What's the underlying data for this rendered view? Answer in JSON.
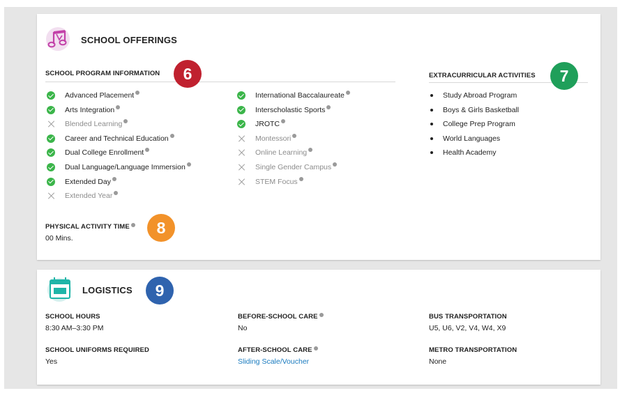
{
  "offerings": {
    "title": "SCHOOL OFFERINGS",
    "program_title": "SCHOOL PROGRAM INFORMATION",
    "program_col1": [
      {
        "label": "Advanced Placement",
        "on": true
      },
      {
        "label": "Arts Integration",
        "on": true
      },
      {
        "label": "Blended Learning",
        "on": false
      },
      {
        "label": "Career and Technical Education",
        "on": true
      },
      {
        "label": "Dual College Enrollment",
        "on": true
      },
      {
        "label": "Dual Language/Language Immersion",
        "on": true
      },
      {
        "label": "Extended Day",
        "on": true
      },
      {
        "label": "Extended Year",
        "on": false
      }
    ],
    "program_col2": [
      {
        "label": "International Baccalaureate",
        "on": true
      },
      {
        "label": "Interscholastic Sports",
        "on": true
      },
      {
        "label": "JROTC",
        "on": true
      },
      {
        "label": "Montessori",
        "on": false
      },
      {
        "label": "Online Learning",
        "on": false
      },
      {
        "label": "Single Gender Campus",
        "on": false
      },
      {
        "label": "STEM Focus",
        "on": false
      }
    ],
    "extra_title": "EXTRACURRICULAR ACTIVITIES",
    "extra_items": [
      "Study Abroad Program",
      "Boys & Girls Basketball",
      "College Prep Program",
      "World Languages",
      "Health Academy"
    ],
    "pa_title": "PHYSICAL ACTIVITY TIME",
    "pa_value": "00 Mins."
  },
  "badges": {
    "b6": {
      "text": "6",
      "color": "#c0212f"
    },
    "b7": {
      "text": "7",
      "color": "#1f9f5a"
    },
    "b8": {
      "text": "8",
      "color": "#f2922a"
    },
    "b9": {
      "text": "9",
      "color": "#2f63ae"
    }
  },
  "logistics": {
    "title": "LOGISTICS",
    "school_hours_label": "SCHOOL HOURS",
    "school_hours_value": "8:30 AM–3:30 PM",
    "before_care_label": "BEFORE-SCHOOL CARE",
    "before_care_value": "No",
    "bus_label": "BUS TRANSPORTATION",
    "bus_value": "U5, U6, V2, V4, W4, X9",
    "uniforms_label": "SCHOOL UNIFORMS REQUIRED",
    "uniforms_value": "Yes",
    "after_care_label": "AFTER-SCHOOL CARE",
    "after_care_value": "Sliding Scale/Voucher",
    "metro_label": "METRO TRANSPORTATION",
    "metro_value": "None"
  },
  "icons": {
    "offerings_icon": "music-notes-icon",
    "logistics_icon": "calendar-icon",
    "info_icon": "info-icon",
    "check_icon": "check-circle-icon",
    "x_icon": "x-icon"
  }
}
